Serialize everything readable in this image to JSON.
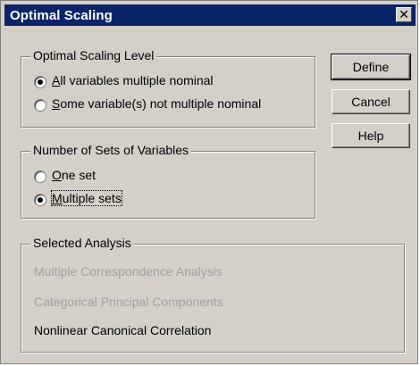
{
  "window": {
    "title": "Optimal Scaling",
    "close_glyph": "✕"
  },
  "scaling_level": {
    "label": "Optimal Scaling Level",
    "options": [
      {
        "prefix": "",
        "hotkey": "A",
        "rest": "ll variables multiple nominal",
        "checked": true
      },
      {
        "prefix": "",
        "hotkey": "S",
        "rest": "ome variable(s) not multiple nominal",
        "checked": false
      }
    ]
  },
  "sets": {
    "label": "Number of Sets of Variables",
    "options": [
      {
        "prefix": "",
        "hotkey": "O",
        "rest": "ne set",
        "checked": false
      },
      {
        "prefix": "",
        "hotkey": "M",
        "rest": "ultiple sets",
        "checked": true
      }
    ]
  },
  "analysis": {
    "label": "Selected Analysis",
    "items": [
      {
        "text": "Multiple Correspondence Analysis",
        "enabled": false
      },
      {
        "text": "Categorical Principal Components",
        "enabled": false
      },
      {
        "text": "Nonlinear Canonical Correlation",
        "enabled": true
      }
    ]
  },
  "buttons": {
    "define": "Define",
    "cancel": "Cancel",
    "help": "Help"
  }
}
